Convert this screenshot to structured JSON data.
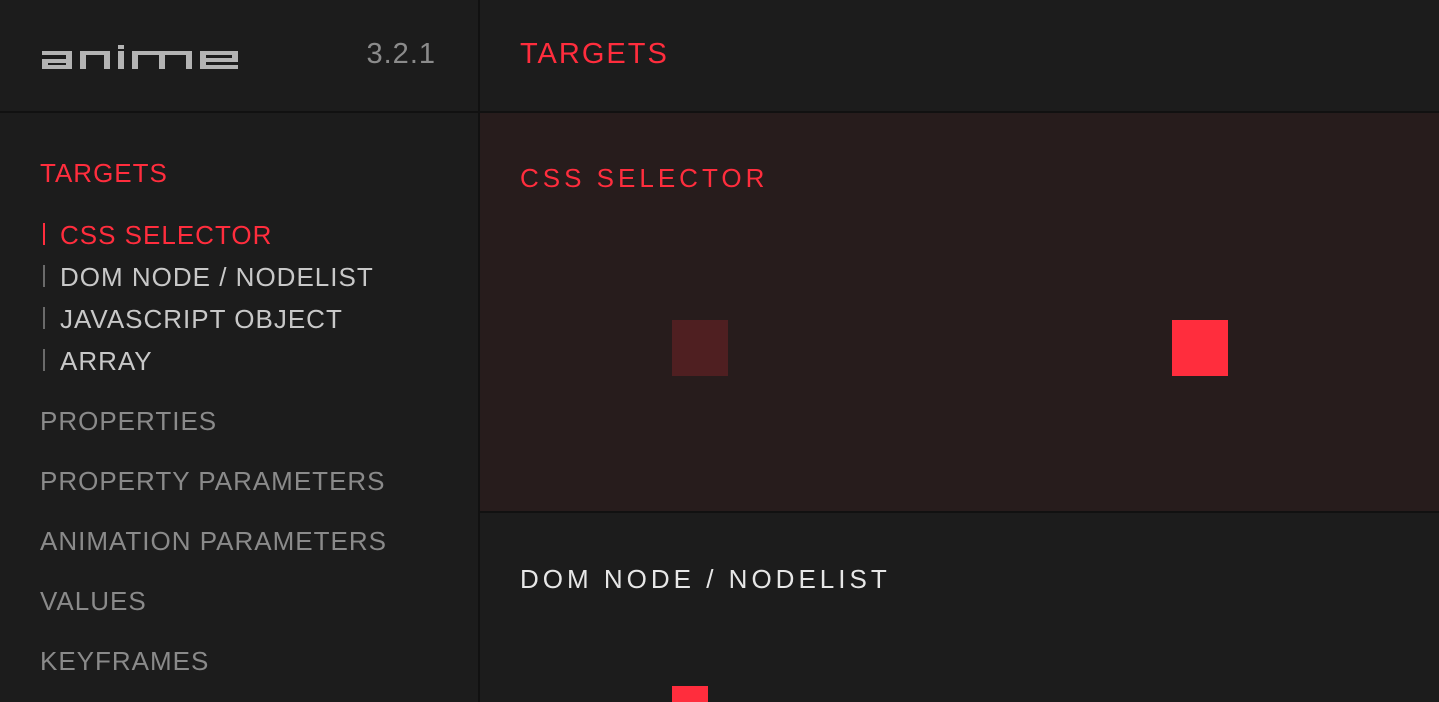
{
  "app": {
    "logo_text": "anime",
    "version": "3.2.1"
  },
  "sidebar": {
    "sections": [
      {
        "label": "TARGETS",
        "active": true
      },
      {
        "label": "PROPERTIES",
        "active": false
      },
      {
        "label": "PROPERTY PARAMETERS",
        "active": false
      },
      {
        "label": "ANIMATION PARAMETERS",
        "active": false
      },
      {
        "label": "VALUES",
        "active": false
      },
      {
        "label": "KEYFRAMES",
        "active": false
      }
    ],
    "target_items": [
      {
        "label": "CSS SELECTOR",
        "active": true
      },
      {
        "label": "DOM NODE / NODELIST",
        "active": false
      },
      {
        "label": "JAVASCRIPT OBJECT",
        "active": false
      },
      {
        "label": "ARRAY",
        "active": false
      }
    ]
  },
  "main": {
    "title": "TARGETS",
    "demos": [
      {
        "title": "CSS SELECTOR",
        "active": true
      },
      {
        "title": "DOM NODE / NODELIST",
        "active": false
      }
    ]
  },
  "colors": {
    "accent": "#ff2d3d",
    "background": "#1c1c1c",
    "active_panel": "#271c1c",
    "ghost_square": "#4f1f21",
    "muted_text": "#8a8a8a"
  }
}
